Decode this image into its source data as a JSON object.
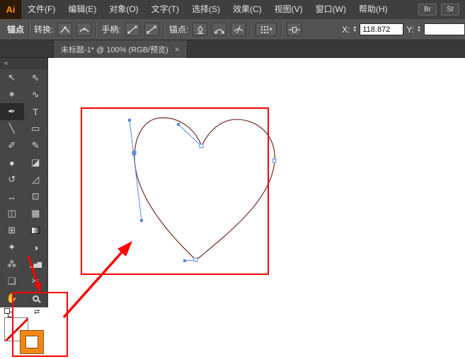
{
  "app": {
    "logo_text": "Ai"
  },
  "menubar": {
    "items": [
      {
        "label": "文件(F)"
      },
      {
        "label": "编辑(E)"
      },
      {
        "label": "对象(O)"
      },
      {
        "label": "文字(T)"
      },
      {
        "label": "选择(S)"
      },
      {
        "label": "效果(C)"
      },
      {
        "label": "视图(V)"
      },
      {
        "label": "窗口(W)"
      },
      {
        "label": "帮助(H)"
      }
    ],
    "right_buttons": [
      {
        "label": "Br"
      },
      {
        "label": "St"
      }
    ]
  },
  "control_bar": {
    "anchor_label": "锚点",
    "convert_label": "转换:",
    "handles_label": "手柄:",
    "anchor_ops_label": "锚点:",
    "x_label": "X:",
    "x_value": "118.872",
    "y_label": "Y:"
  },
  "tab": {
    "title": "未标题-1* @ 100% (RGB/预览)",
    "close_label": "×"
  },
  "toolbar": {
    "collapse_label": "«",
    "tools": [
      {
        "name": "selection-tool",
        "glyph": "↖"
      },
      {
        "name": "direct-selection-tool",
        "glyph": "⇖"
      },
      {
        "name": "magic-wand-tool",
        "glyph": "✶"
      },
      {
        "name": "lasso-tool",
        "glyph": "∿"
      },
      {
        "name": "pen-tool",
        "glyph": "✒",
        "selected": true
      },
      {
        "name": "type-tool",
        "glyph": "T"
      },
      {
        "name": "line-segment-tool",
        "glyph": "╲"
      },
      {
        "name": "rectangle-tool",
        "glyph": "▭"
      },
      {
        "name": "paintbrush-tool",
        "glyph": "✐"
      },
      {
        "name": "pencil-tool",
        "glyph": "✎"
      },
      {
        "name": "blob-brush-tool",
        "glyph": "●"
      },
      {
        "name": "eraser-tool",
        "glyph": "◪"
      },
      {
        "name": "rotate-tool",
        "glyph": "↺"
      },
      {
        "name": "scale-tool",
        "glyph": "◿"
      },
      {
        "name": "width-tool",
        "glyph": "↔"
      },
      {
        "name": "free-transform-tool",
        "glyph": "⊡"
      },
      {
        "name": "shape-builder-tool",
        "glyph": "◫"
      },
      {
        "name": "perspective-grid-tool",
        "glyph": "▦"
      },
      {
        "name": "mesh-tool",
        "glyph": "⊞"
      },
      {
        "name": "gradient-tool",
        "glyph": ""
      },
      {
        "name": "eyedropper-tool",
        "glyph": "✦"
      },
      {
        "name": "blend-tool",
        "glyph": "◑"
      },
      {
        "name": "symbol-sprayer-tool",
        "glyph": "⁂"
      },
      {
        "name": "column-graph-tool",
        "glyph": "▂▅▇"
      },
      {
        "name": "artboard-tool",
        "glyph": "❏"
      },
      {
        "name": "slice-tool",
        "glyph": "✂"
      },
      {
        "name": "hand-tool",
        "glyph": "✋"
      },
      {
        "name": "zoom-tool",
        "glyph": ""
      }
    ]
  },
  "swatches": {
    "fill": "none",
    "stroke_color": "#f28718"
  },
  "colors": {
    "annotation_red": "#ff0000",
    "selection_blue": "#5b86e5",
    "heart_path_stroke": "#7a3b32",
    "accent_orange": "#f28718",
    "logo_orange": "#ff8a00"
  }
}
